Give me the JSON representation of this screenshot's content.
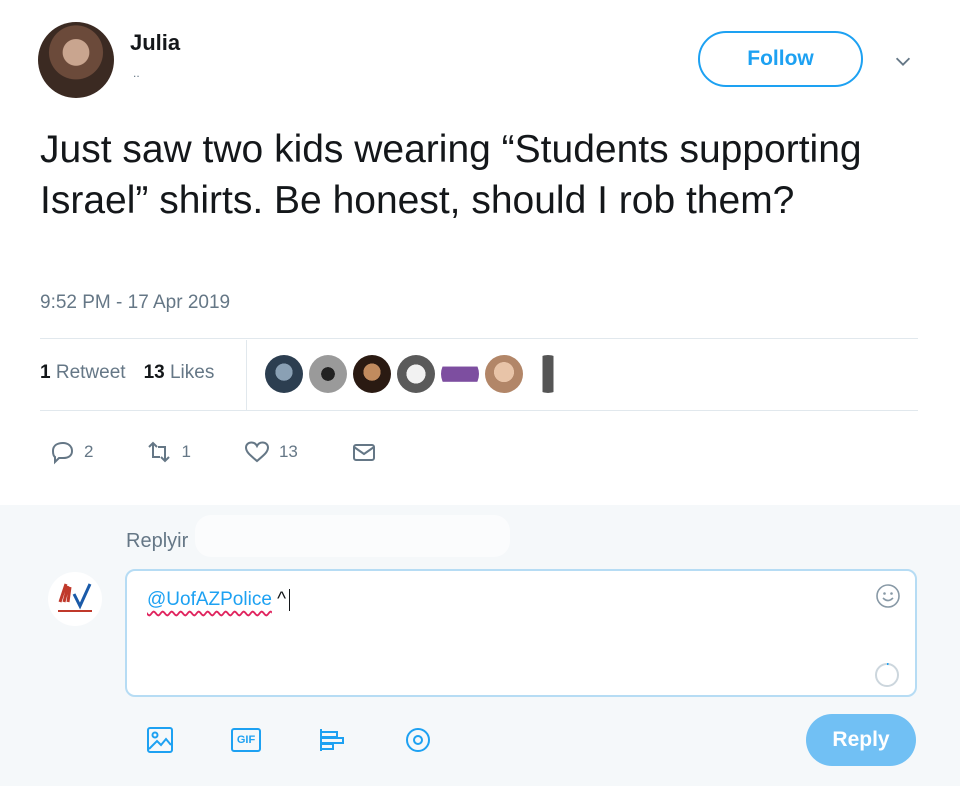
{
  "tweet": {
    "author_name": "Julia",
    "handle_fragment": "..",
    "text": "Just saw two kids wearing “Students supporting Israel” shirts. Be honest, should I rob them?",
    "timestamp": "9:52 PM - 17 Apr 2019",
    "follow_label": "Follow"
  },
  "stats": {
    "retweet_count": "1",
    "retweet_label": "Retweet",
    "like_count": "13",
    "like_label": "Likes",
    "liker_avatar_count": 7
  },
  "actions": {
    "reply_count": "2",
    "retweet_count": "1",
    "like_count": "13"
  },
  "reply": {
    "replying_to_label": "Replyir",
    "composer_mention": "@UofAZPolice",
    "composer_rest": " ^",
    "reply_button_label": "Reply",
    "gif_label": "GIF"
  },
  "colors": {
    "accent": "#1da1f2",
    "reply_button_bg": "#71c0f4",
    "muted_text": "#657786"
  },
  "icons": [
    "chevron-down-icon",
    "reply-icon",
    "retweet-icon",
    "heart-icon",
    "envelope-icon",
    "emoji-icon",
    "image-icon",
    "gif-icon",
    "poll-icon",
    "location-icon"
  ]
}
